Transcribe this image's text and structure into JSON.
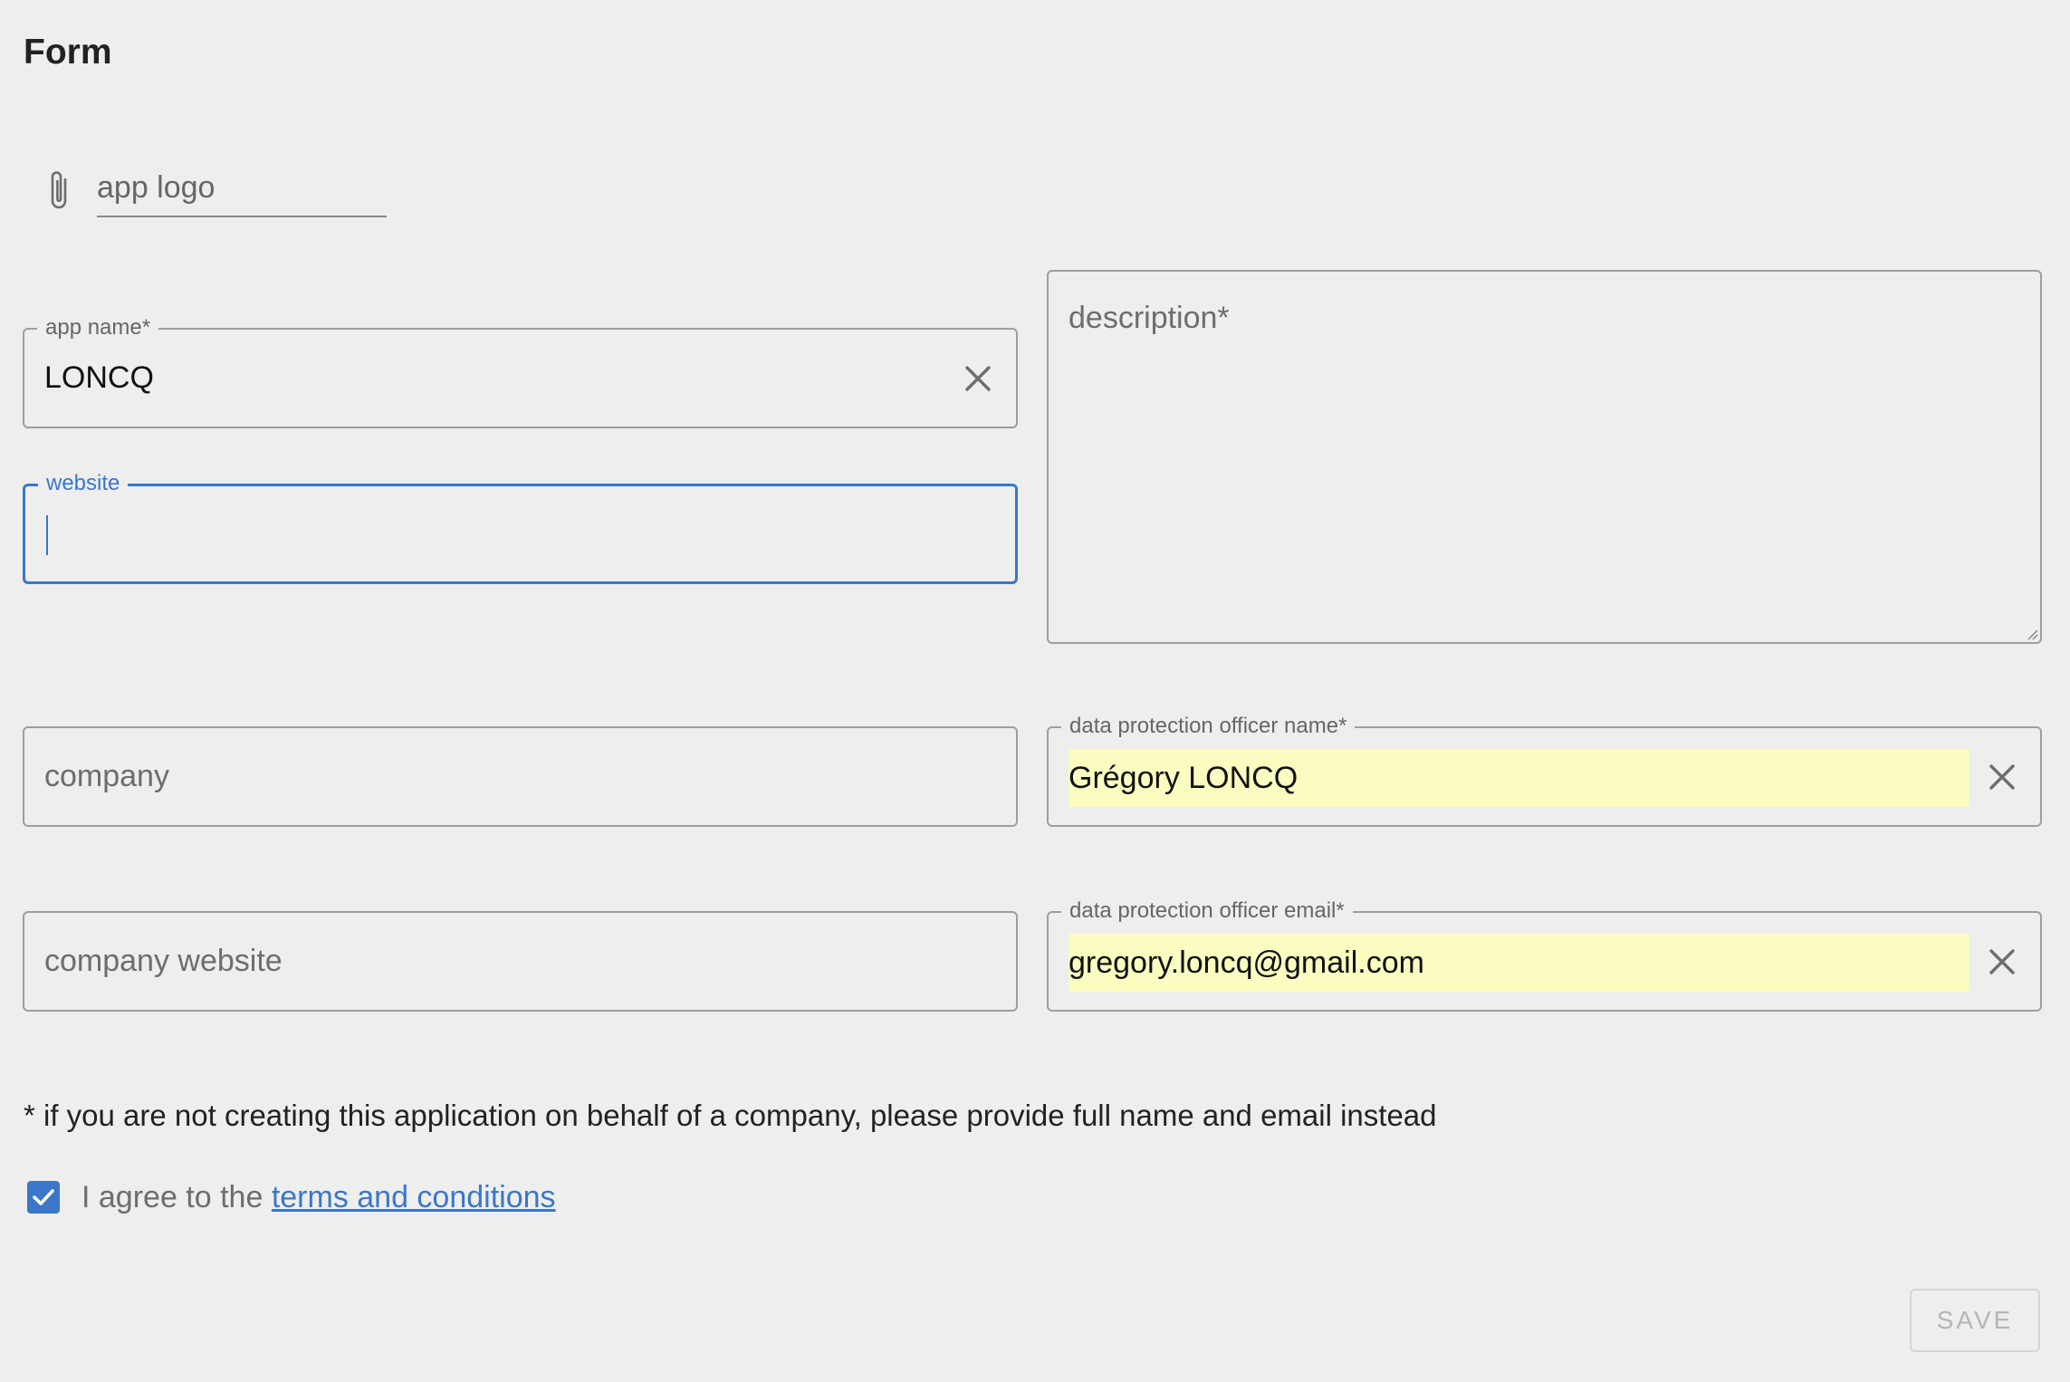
{
  "form": {
    "title": "Form",
    "app_logo": {
      "label": "app logo",
      "icon": "paperclip-icon"
    },
    "app_name": {
      "label": "app name*",
      "value": "LONCQ",
      "clear_icon": "close-icon"
    },
    "website": {
      "label": "website",
      "value": "",
      "focused": true
    },
    "description": {
      "placeholder": "description*",
      "value": ""
    },
    "company": {
      "placeholder": "company",
      "value": ""
    },
    "company_website": {
      "placeholder": "company website",
      "value": ""
    },
    "dpo_name": {
      "label": "data protection officer name*",
      "value": "Grégory LONCQ",
      "clear_icon": "close-icon"
    },
    "dpo_email": {
      "label": "data protection officer email*",
      "value": "gregory.loncq@gmail.com",
      "clear_icon": "close-icon"
    },
    "note": "* if you are not creating this application on behalf of a company, please provide full name and email instead",
    "agree": {
      "checked": true,
      "text": "I agree to the ",
      "link_text": "terms and conditions"
    },
    "save_label": "SAVE"
  },
  "colors": {
    "background": "#eeeeee",
    "accent": "#3a77c9",
    "autofill": "#fafcc0",
    "border": "#9e9e9e"
  }
}
